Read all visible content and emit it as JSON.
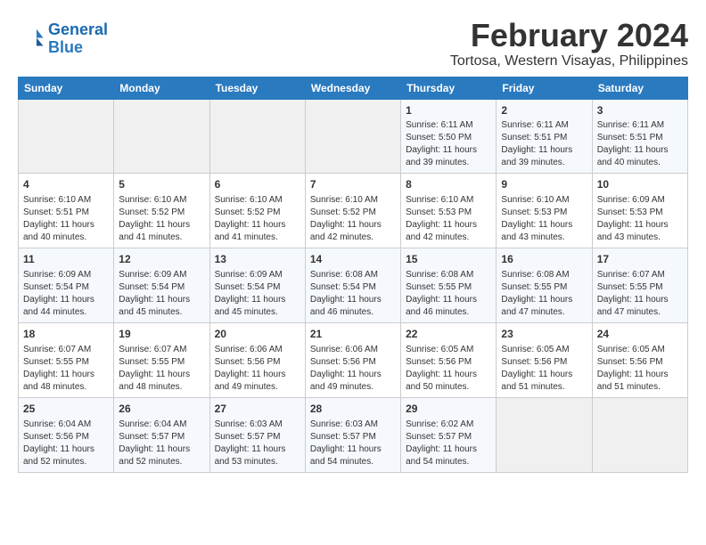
{
  "logo": {
    "text_general": "General",
    "text_blue": "Blue"
  },
  "title": "February 2024",
  "subtitle": "Tortosa, Western Visayas, Philippines",
  "days_of_week": [
    "Sunday",
    "Monday",
    "Tuesday",
    "Wednesday",
    "Thursday",
    "Friday",
    "Saturday"
  ],
  "weeks": [
    [
      {
        "day": "",
        "content": ""
      },
      {
        "day": "",
        "content": ""
      },
      {
        "day": "",
        "content": ""
      },
      {
        "day": "",
        "content": ""
      },
      {
        "day": "1",
        "content": "Sunrise: 6:11 AM\nSunset: 5:50 PM\nDaylight: 11 hours and 39 minutes."
      },
      {
        "day": "2",
        "content": "Sunrise: 6:11 AM\nSunset: 5:51 PM\nDaylight: 11 hours and 39 minutes."
      },
      {
        "day": "3",
        "content": "Sunrise: 6:11 AM\nSunset: 5:51 PM\nDaylight: 11 hours and 40 minutes."
      }
    ],
    [
      {
        "day": "4",
        "content": "Sunrise: 6:10 AM\nSunset: 5:51 PM\nDaylight: 11 hours and 40 minutes."
      },
      {
        "day": "5",
        "content": "Sunrise: 6:10 AM\nSunset: 5:52 PM\nDaylight: 11 hours and 41 minutes."
      },
      {
        "day": "6",
        "content": "Sunrise: 6:10 AM\nSunset: 5:52 PM\nDaylight: 11 hours and 41 minutes."
      },
      {
        "day": "7",
        "content": "Sunrise: 6:10 AM\nSunset: 5:52 PM\nDaylight: 11 hours and 42 minutes."
      },
      {
        "day": "8",
        "content": "Sunrise: 6:10 AM\nSunset: 5:53 PM\nDaylight: 11 hours and 42 minutes."
      },
      {
        "day": "9",
        "content": "Sunrise: 6:10 AM\nSunset: 5:53 PM\nDaylight: 11 hours and 43 minutes."
      },
      {
        "day": "10",
        "content": "Sunrise: 6:09 AM\nSunset: 5:53 PM\nDaylight: 11 hours and 43 minutes."
      }
    ],
    [
      {
        "day": "11",
        "content": "Sunrise: 6:09 AM\nSunset: 5:54 PM\nDaylight: 11 hours and 44 minutes."
      },
      {
        "day": "12",
        "content": "Sunrise: 6:09 AM\nSunset: 5:54 PM\nDaylight: 11 hours and 45 minutes."
      },
      {
        "day": "13",
        "content": "Sunrise: 6:09 AM\nSunset: 5:54 PM\nDaylight: 11 hours and 45 minutes."
      },
      {
        "day": "14",
        "content": "Sunrise: 6:08 AM\nSunset: 5:54 PM\nDaylight: 11 hours and 46 minutes."
      },
      {
        "day": "15",
        "content": "Sunrise: 6:08 AM\nSunset: 5:55 PM\nDaylight: 11 hours and 46 minutes."
      },
      {
        "day": "16",
        "content": "Sunrise: 6:08 AM\nSunset: 5:55 PM\nDaylight: 11 hours and 47 minutes."
      },
      {
        "day": "17",
        "content": "Sunrise: 6:07 AM\nSunset: 5:55 PM\nDaylight: 11 hours and 47 minutes."
      }
    ],
    [
      {
        "day": "18",
        "content": "Sunrise: 6:07 AM\nSunset: 5:55 PM\nDaylight: 11 hours and 48 minutes."
      },
      {
        "day": "19",
        "content": "Sunrise: 6:07 AM\nSunset: 5:55 PM\nDaylight: 11 hours and 48 minutes."
      },
      {
        "day": "20",
        "content": "Sunrise: 6:06 AM\nSunset: 5:56 PM\nDaylight: 11 hours and 49 minutes."
      },
      {
        "day": "21",
        "content": "Sunrise: 6:06 AM\nSunset: 5:56 PM\nDaylight: 11 hours and 49 minutes."
      },
      {
        "day": "22",
        "content": "Sunrise: 6:05 AM\nSunset: 5:56 PM\nDaylight: 11 hours and 50 minutes."
      },
      {
        "day": "23",
        "content": "Sunrise: 6:05 AM\nSunset: 5:56 PM\nDaylight: 11 hours and 51 minutes."
      },
      {
        "day": "24",
        "content": "Sunrise: 6:05 AM\nSunset: 5:56 PM\nDaylight: 11 hours and 51 minutes."
      }
    ],
    [
      {
        "day": "25",
        "content": "Sunrise: 6:04 AM\nSunset: 5:56 PM\nDaylight: 11 hours and 52 minutes."
      },
      {
        "day": "26",
        "content": "Sunrise: 6:04 AM\nSunset: 5:57 PM\nDaylight: 11 hours and 52 minutes."
      },
      {
        "day": "27",
        "content": "Sunrise: 6:03 AM\nSunset: 5:57 PM\nDaylight: 11 hours and 53 minutes."
      },
      {
        "day": "28",
        "content": "Sunrise: 6:03 AM\nSunset: 5:57 PM\nDaylight: 11 hours and 54 minutes."
      },
      {
        "day": "29",
        "content": "Sunrise: 6:02 AM\nSunset: 5:57 PM\nDaylight: 11 hours and 54 minutes."
      },
      {
        "day": "",
        "content": ""
      },
      {
        "day": "",
        "content": ""
      }
    ]
  ]
}
